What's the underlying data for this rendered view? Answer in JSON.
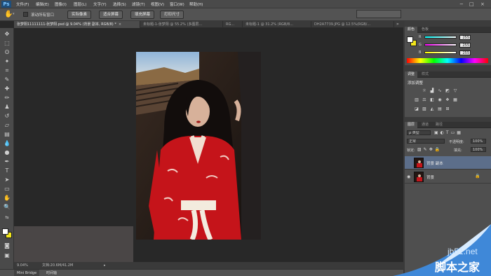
{
  "app": {
    "logo": "Ps"
  },
  "menubar": {
    "items": [
      "文件(F)",
      "编辑(E)",
      "图像(I)",
      "图层(L)",
      "文字(Y)",
      "选择(S)",
      "滤镜(T)",
      "视图(V)",
      "窗口(W)",
      "帮助(H)"
    ],
    "window_controls": [
      "−",
      "□",
      "×"
    ]
  },
  "options": {
    "scroll_all_label": "滚动所有窗口",
    "actual_pixels": "实际像素",
    "fit_screen": "适合屏幕",
    "fill_screen": "填充屏幕",
    "print_size": "打印尺寸"
  },
  "doc_tabs": [
    {
      "label": "张梦阳11111111-张梦阳.psd @ 9.04% (背景 副本, RGB/8) *",
      "active": true
    },
    {
      "label": "未标题-1-张梦阳 @ 55.2% (多图层...",
      "active": false
    },
    {
      "label": "RG...",
      "active": false
    },
    {
      "label": "未标题-1 @ 31.2% (RGB/8...",
      "active": false
    },
    {
      "label": "DH2A7739.JPG @ 12.5%(RGB/...",
      "active": false
    }
  ],
  "tools": [
    "selection-tool",
    "marquee-tool",
    "lasso-tool",
    "magic-wand-tool",
    "crop-tool",
    "eyedropper-tool",
    "healing-tool",
    "brush-tool",
    "stamp-tool",
    "history-brush-tool",
    "eraser-tool",
    "gradient-tool",
    "blur-tool",
    "dodge-tool",
    "pen-tool",
    "type-tool",
    "path-select-tool",
    "shape-tool",
    "hand-tool",
    "zoom-tool"
  ],
  "colors": {
    "foreground": "#ffffff",
    "background": "#f2e61a",
    "accent": "#5c6e8a",
    "canvas": "#282828"
  },
  "status": {
    "zoom": "9.04%",
    "doc": "文档:20.6M/41.2M"
  },
  "bottom_tabs": [
    "Mini Bridge",
    "时间轴"
  ],
  "color_panel": {
    "tabs": [
      "颜色",
      "色板"
    ],
    "channels": [
      {
        "label": "R",
        "value": "255"
      },
      {
        "label": "G",
        "value": "255"
      },
      {
        "label": "B",
        "value": "255"
      }
    ]
  },
  "adjustments_panel": {
    "tabs": [
      "调整",
      "样式"
    ],
    "title": "添加调整"
  },
  "layers_panel": {
    "tabs": [
      "图层",
      "通道",
      "路径"
    ],
    "filter_label": "ρ 类型",
    "blend_mode": "正常",
    "opacity_label": "不透明度:",
    "opacity_value": "100%",
    "lock_label": "锁定:",
    "fill_label": "填充:",
    "fill_value": "100%",
    "layers": [
      {
        "name": "背景 副本",
        "selected": true,
        "visible": false
      },
      {
        "name": "背景",
        "selected": false,
        "visible": true
      }
    ]
  },
  "watermark": {
    "site": "jb51.net",
    "name": "脚本之家"
  }
}
